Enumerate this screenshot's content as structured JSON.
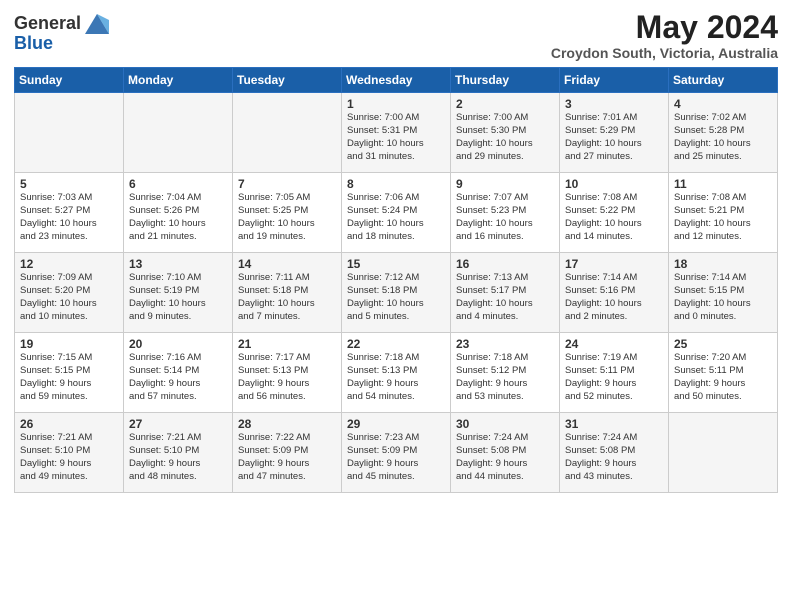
{
  "header": {
    "logo_line1": "General",
    "logo_line2": "Blue",
    "month": "May 2024",
    "location": "Croydon South, Victoria, Australia"
  },
  "days_of_week": [
    "Sunday",
    "Monday",
    "Tuesday",
    "Wednesday",
    "Thursday",
    "Friday",
    "Saturday"
  ],
  "weeks": [
    [
      {
        "day": "",
        "info": ""
      },
      {
        "day": "",
        "info": ""
      },
      {
        "day": "",
        "info": ""
      },
      {
        "day": "1",
        "info": "Sunrise: 7:00 AM\nSunset: 5:31 PM\nDaylight: 10 hours\nand 31 minutes."
      },
      {
        "day": "2",
        "info": "Sunrise: 7:00 AM\nSunset: 5:30 PM\nDaylight: 10 hours\nand 29 minutes."
      },
      {
        "day": "3",
        "info": "Sunrise: 7:01 AM\nSunset: 5:29 PM\nDaylight: 10 hours\nand 27 minutes."
      },
      {
        "day": "4",
        "info": "Sunrise: 7:02 AM\nSunset: 5:28 PM\nDaylight: 10 hours\nand 25 minutes."
      }
    ],
    [
      {
        "day": "5",
        "info": "Sunrise: 7:03 AM\nSunset: 5:27 PM\nDaylight: 10 hours\nand 23 minutes."
      },
      {
        "day": "6",
        "info": "Sunrise: 7:04 AM\nSunset: 5:26 PM\nDaylight: 10 hours\nand 21 minutes."
      },
      {
        "day": "7",
        "info": "Sunrise: 7:05 AM\nSunset: 5:25 PM\nDaylight: 10 hours\nand 19 minutes."
      },
      {
        "day": "8",
        "info": "Sunrise: 7:06 AM\nSunset: 5:24 PM\nDaylight: 10 hours\nand 18 minutes."
      },
      {
        "day": "9",
        "info": "Sunrise: 7:07 AM\nSunset: 5:23 PM\nDaylight: 10 hours\nand 16 minutes."
      },
      {
        "day": "10",
        "info": "Sunrise: 7:08 AM\nSunset: 5:22 PM\nDaylight: 10 hours\nand 14 minutes."
      },
      {
        "day": "11",
        "info": "Sunrise: 7:08 AM\nSunset: 5:21 PM\nDaylight: 10 hours\nand 12 minutes."
      }
    ],
    [
      {
        "day": "12",
        "info": "Sunrise: 7:09 AM\nSunset: 5:20 PM\nDaylight: 10 hours\nand 10 minutes."
      },
      {
        "day": "13",
        "info": "Sunrise: 7:10 AM\nSunset: 5:19 PM\nDaylight: 10 hours\nand 9 minutes."
      },
      {
        "day": "14",
        "info": "Sunrise: 7:11 AM\nSunset: 5:18 PM\nDaylight: 10 hours\nand 7 minutes."
      },
      {
        "day": "15",
        "info": "Sunrise: 7:12 AM\nSunset: 5:18 PM\nDaylight: 10 hours\nand 5 minutes."
      },
      {
        "day": "16",
        "info": "Sunrise: 7:13 AM\nSunset: 5:17 PM\nDaylight: 10 hours\nand 4 minutes."
      },
      {
        "day": "17",
        "info": "Sunrise: 7:14 AM\nSunset: 5:16 PM\nDaylight: 10 hours\nand 2 minutes."
      },
      {
        "day": "18",
        "info": "Sunrise: 7:14 AM\nSunset: 5:15 PM\nDaylight: 10 hours\nand 0 minutes."
      }
    ],
    [
      {
        "day": "19",
        "info": "Sunrise: 7:15 AM\nSunset: 5:15 PM\nDaylight: 9 hours\nand 59 minutes."
      },
      {
        "day": "20",
        "info": "Sunrise: 7:16 AM\nSunset: 5:14 PM\nDaylight: 9 hours\nand 57 minutes."
      },
      {
        "day": "21",
        "info": "Sunrise: 7:17 AM\nSunset: 5:13 PM\nDaylight: 9 hours\nand 56 minutes."
      },
      {
        "day": "22",
        "info": "Sunrise: 7:18 AM\nSunset: 5:13 PM\nDaylight: 9 hours\nand 54 minutes."
      },
      {
        "day": "23",
        "info": "Sunrise: 7:18 AM\nSunset: 5:12 PM\nDaylight: 9 hours\nand 53 minutes."
      },
      {
        "day": "24",
        "info": "Sunrise: 7:19 AM\nSunset: 5:11 PM\nDaylight: 9 hours\nand 52 minutes."
      },
      {
        "day": "25",
        "info": "Sunrise: 7:20 AM\nSunset: 5:11 PM\nDaylight: 9 hours\nand 50 minutes."
      }
    ],
    [
      {
        "day": "26",
        "info": "Sunrise: 7:21 AM\nSunset: 5:10 PM\nDaylight: 9 hours\nand 49 minutes."
      },
      {
        "day": "27",
        "info": "Sunrise: 7:21 AM\nSunset: 5:10 PM\nDaylight: 9 hours\nand 48 minutes."
      },
      {
        "day": "28",
        "info": "Sunrise: 7:22 AM\nSunset: 5:09 PM\nDaylight: 9 hours\nand 47 minutes."
      },
      {
        "day": "29",
        "info": "Sunrise: 7:23 AM\nSunset: 5:09 PM\nDaylight: 9 hours\nand 45 minutes."
      },
      {
        "day": "30",
        "info": "Sunrise: 7:24 AM\nSunset: 5:08 PM\nDaylight: 9 hours\nand 44 minutes."
      },
      {
        "day": "31",
        "info": "Sunrise: 7:24 AM\nSunset: 5:08 PM\nDaylight: 9 hours\nand 43 minutes."
      },
      {
        "day": "",
        "info": ""
      }
    ]
  ]
}
